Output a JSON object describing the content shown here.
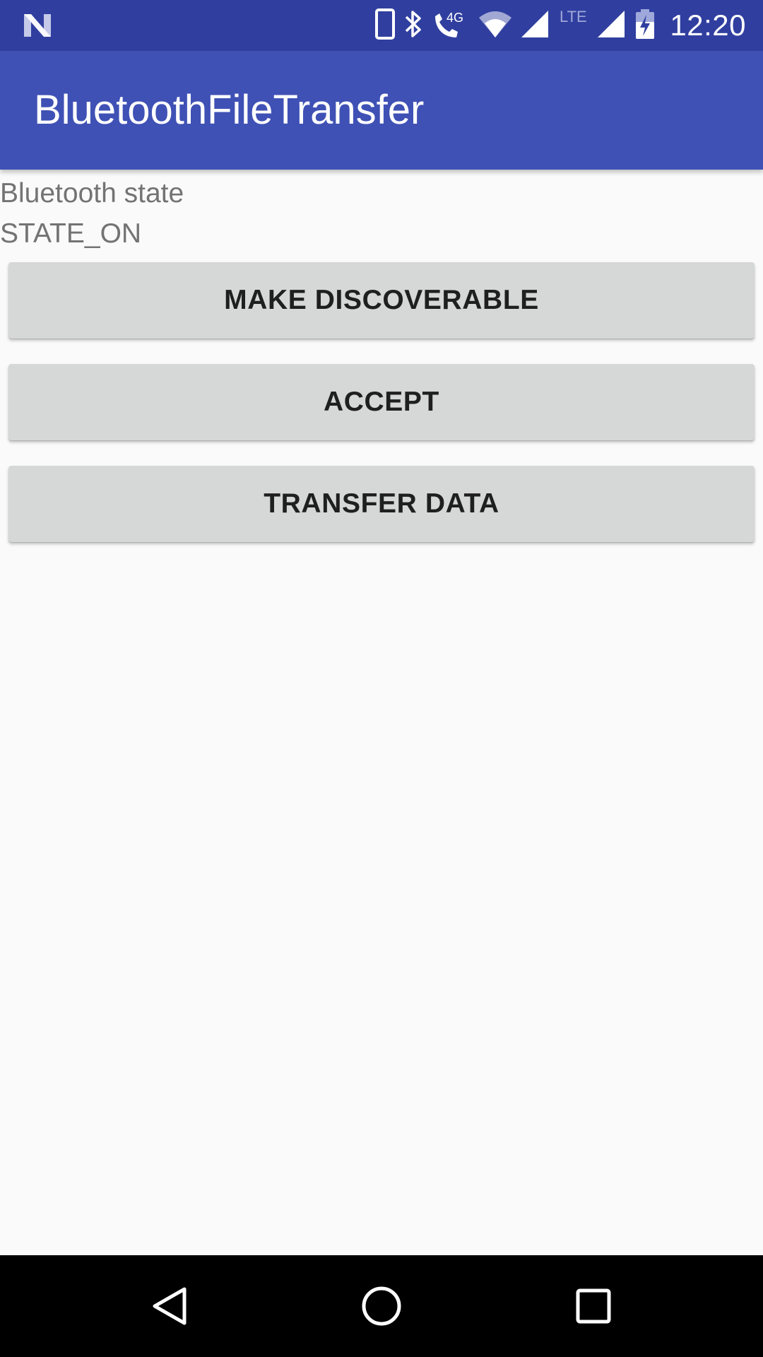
{
  "status_bar": {
    "time": "12:20",
    "network_label": "4G",
    "lte_label": "LTE",
    "icons": [
      "notification-n-icon",
      "phone-icon",
      "bluetooth-icon",
      "call-4g-icon",
      "wifi-icon",
      "signal-icon",
      "lte-signal-icon",
      "battery-charging-icon"
    ]
  },
  "app_bar": {
    "title": "BluetoothFileTransfer",
    "color": "#3f51b5",
    "status_color": "#303f9f"
  },
  "main": {
    "state_label": "Bluetooth state",
    "state_value": "STATE_ON",
    "buttons": [
      {
        "label": "MAKE DISCOVERABLE"
      },
      {
        "label": "ACCEPT"
      },
      {
        "label": "TRANSFER DATA"
      }
    ]
  },
  "nav_bar": {
    "icons": [
      "back-icon",
      "home-icon",
      "recents-icon"
    ]
  }
}
